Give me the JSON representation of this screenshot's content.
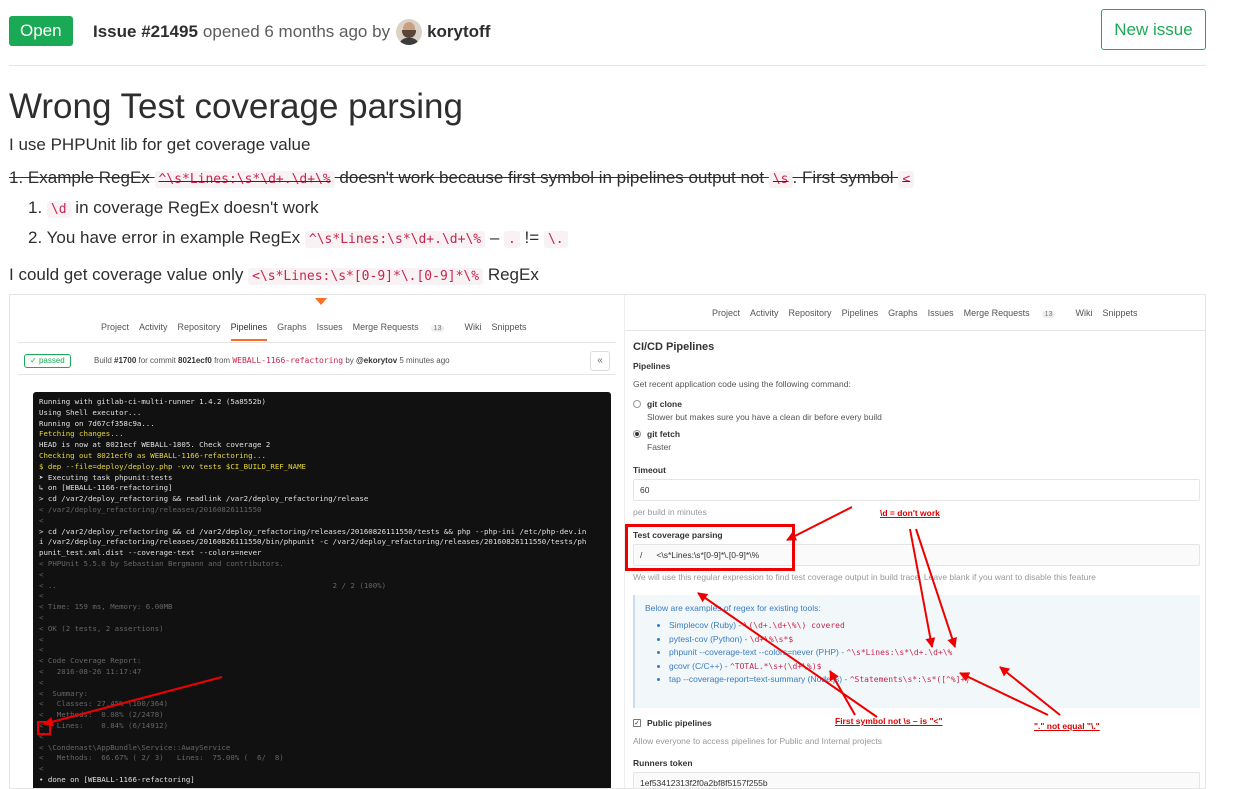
{
  "issue": {
    "status": "Open",
    "number_label": "Issue #21495",
    "opened_text": "opened 6 months ago by",
    "author": "korytoff",
    "new_issue_label": "New issue",
    "title": "Wrong Test coverage parsing"
  },
  "description": {
    "intro": "I use PHPUnit lib for get coverage value",
    "struck": {
      "p1": "1. Example RegEx ",
      "code1": "^\\s*Lines:\\s*\\d+.\\d+\\%",
      "p2": " doesn't work because first symbol in pipelines output not ",
      "code2": "\\s",
      "p3": ". First symbol ",
      "code3": "<"
    },
    "item1": {
      "num": "1.",
      "code": "\\d",
      "text": " in coverage RegEx doesn't work"
    },
    "item2": {
      "num": "2.",
      "text1": "You have error in example RegEx ",
      "code1": "^\\s*Lines:\\s*\\d+.\\d+\\%",
      "text2": " – ",
      "code2": ".",
      "text3": " != ",
      "code3": "\\."
    },
    "last": {
      "text1": "I could get coverage value only ",
      "code": "<\\s*Lines:\\s*[0-9]*\\.[0-9]*\\%",
      "text2": " RegEx"
    }
  },
  "screenshot": {
    "left_nav": [
      "Project",
      "Activity",
      "Repository",
      "Pipelines",
      "Graphs",
      "Issues",
      "Merge Requests",
      "Wiki",
      "Snippets"
    ],
    "left_nav_count": "13",
    "build": {
      "status": "passed",
      "t1": "Build ",
      "num": "#1700",
      "t2": " for commit ",
      "commit": "8021ecf0",
      "t3": " from ",
      "branch": "WEBALL-1166-refactoring",
      "t4": " by ",
      "user": "@ekorytov",
      "t5": " 5 minutes ago",
      "collapse": "«"
    },
    "terminal_lines": [
      {
        "c": "",
        "t": "Running with gitlab-ci-multi-runner 1.4.2 (5a8552b)"
      },
      {
        "c": "",
        "t": "Using Shell executor..."
      },
      {
        "c": "",
        "t": "Running on 7d67cf358c9a..."
      },
      {
        "c": "y",
        "t": "Fetching changes..."
      },
      {
        "c": "",
        "t": "HEAD is now at 8021ecf WEBALL-1805. Check coverage 2"
      },
      {
        "c": "y",
        "t": "Checking out 8021ecf0 as WEBALL-1166-refactoring..."
      },
      {
        "c": "y",
        "t": "$ dep --file=deploy/deploy.php -vvv tests $CI_BUILD_REF_NAME"
      },
      {
        "c": "",
        "t": "➤ Executing task phpunit:tests"
      },
      {
        "c": "",
        "t": "↳ on [WEBALL-1166-refactoring]"
      },
      {
        "c": "",
        "t": "> cd /var2/deploy_refactoring && readlink /var2/deploy_refactoring/release"
      },
      {
        "c": "g",
        "t": "< /var2/deploy_refactoring/releases/20160826111550"
      },
      {
        "c": "g",
        "t": "<"
      },
      {
        "c": "",
        "t": "> cd /var2/deploy_refactoring && cd /var2/deploy_refactoring/releases/20160826111550/tests && php --php-ini /etc/php-dev.in"
      },
      {
        "c": "",
        "t": "i /var2/deploy_refactoring/releases/20160826111550/bin/phpunit -c /var2/deploy_refactoring/releases/20160826111550/tests/ph"
      },
      {
        "c": "",
        "t": "punit_test.xml.dist --coverage-text --colors=never"
      },
      {
        "c": "g",
        "t": "< PHPUnit 5.5.0 by Sebastian Bergmann and contributors."
      },
      {
        "c": "g",
        "t": "<"
      },
      {
        "c": "g",
        "t": "< ..                                                              2 / 2 (100%)"
      },
      {
        "c": "g",
        "t": "<"
      },
      {
        "c": "g",
        "t": "< Time: 159 ms, Memory: 6.00MB"
      },
      {
        "c": "g",
        "t": "<"
      },
      {
        "c": "g",
        "t": "< OK (2 tests, 2 assertions)"
      },
      {
        "c": "g",
        "t": "<"
      },
      {
        "c": "g",
        "t": "<"
      },
      {
        "c": "g",
        "t": "< Code Coverage Report:"
      },
      {
        "c": "g",
        "t": "<   2016-08-26 11:17:47"
      },
      {
        "c": "g",
        "t": "<"
      },
      {
        "c": "g",
        "t": "<  Summary:"
      },
      {
        "c": "g",
        "t": "<   Classes: 27.45% (100/364)"
      },
      {
        "c": "g",
        "t": "<   Methods:  0.08% (2/2478)"
      },
      {
        "c": "g",
        "t": "<   Lines:    0.84% (6/14912)"
      },
      {
        "c": "g",
        "t": "<"
      },
      {
        "c": "g",
        "t": "< \\Condenast\\AppBundle\\Service::AwayService"
      },
      {
        "c": "g",
        "t": "<   Methods:  66.67% ( 2/ 3)   Lines:  75.00% (  6/  8)"
      },
      {
        "c": "g",
        "t": "<"
      },
      {
        "c": "",
        "t": "• done on [WEBALL-1166-refactoring]"
      }
    ],
    "right_nav": [
      "Project",
      "Activity",
      "Repository",
      "Pipelines",
      "Graphs",
      "Issues",
      "Merge Requests",
      "Wiki",
      "Snippets"
    ],
    "right_nav_count": "13",
    "settings": {
      "heading": "CI/CD Pipelines",
      "pipelines_label": "Pipelines",
      "pipelines_help": "Get recent application code using the following command:",
      "git_clone": "git clone",
      "git_clone_help": "Slower but makes sure you have a clean dir before every build",
      "git_fetch": "git fetch",
      "git_fetch_help": "Faster",
      "timeout_label": "Timeout",
      "timeout_value": "60",
      "timeout_help": "per build in minutes",
      "coverage_label": "Test coverage parsing",
      "coverage_slash": "/",
      "coverage_value": "<\\s*Lines:\\s*[0-9]*\\.[0-9]*\\%",
      "coverage_help": "We will use this regular expression to find test coverage output in build trace. Leave blank if you want to disable this feature",
      "examples_heading": "Below are examples of regex for existing tools:",
      "examples": [
        {
          "tool": "Simplecov (Ruby) - ",
          "regex": "\\(\\d+.\\d+\\%\\) covered"
        },
        {
          "tool": "pytest-cov (Python) - ",
          "regex": "\\d+\\%\\s*$"
        },
        {
          "tool": "phpunit --coverage-text --colors=never (PHP) - ",
          "regex": "^\\s*Lines:\\s*\\d+.\\d+\\%"
        },
        {
          "tool": "gcovr (C/C++) - ",
          "regex": "^TOTAL.*\\s+(\\d+\\%)$"
        },
        {
          "tool": "tap --coverage-report=text-summary (Node.js) - ",
          "regex": "^Statements\\s*:\\s*([^%]+)"
        }
      ],
      "public_pipelines": "Public pipelines",
      "public_help": "Allow everyone to access pipelines for Public and Internal projects",
      "runners_label": "Runners token",
      "runners_value": "1ef53412313f2f0a2bf8f5157f255b"
    },
    "annotations": {
      "d_dont_work": "\\d = don't work",
      "first_symbol": "First symbol not \\s – is \"<\"",
      "dot_not_equal": "\".\" not equal \"\\.\""
    }
  }
}
